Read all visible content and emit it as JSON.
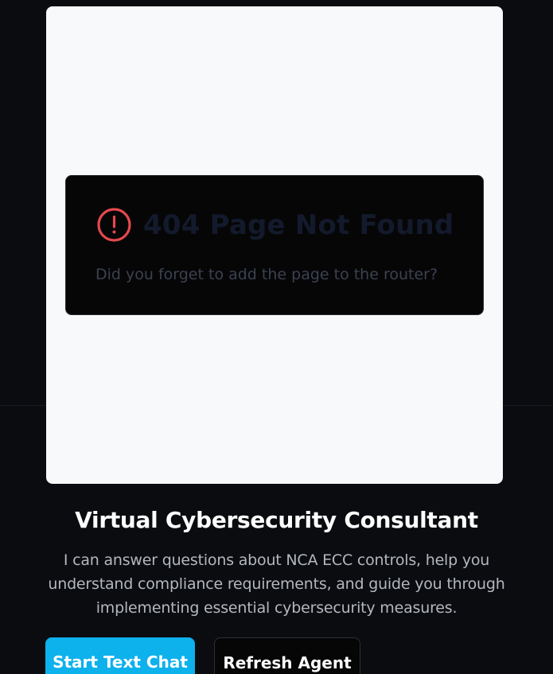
{
  "error_card": {
    "icon": "alert-circle-icon",
    "title": "404 Page Not Found",
    "message": "Did you forget to add the page to the router?"
  },
  "consultant": {
    "title": "Virtual Cybersecurity Consultant",
    "description": "I can answer questions about NCA ECC controls, help you understand compliance requirements, and guide you through implementing essential cybersecurity measures."
  },
  "actions": {
    "start_chat_label": "Start Text Chat",
    "refresh_label": "Refresh Agent"
  },
  "colors": {
    "background": "#0b0c0f",
    "frame": "#f8f9fb",
    "error_icon": "#e5484d",
    "primary_button": "#0db1ec"
  }
}
